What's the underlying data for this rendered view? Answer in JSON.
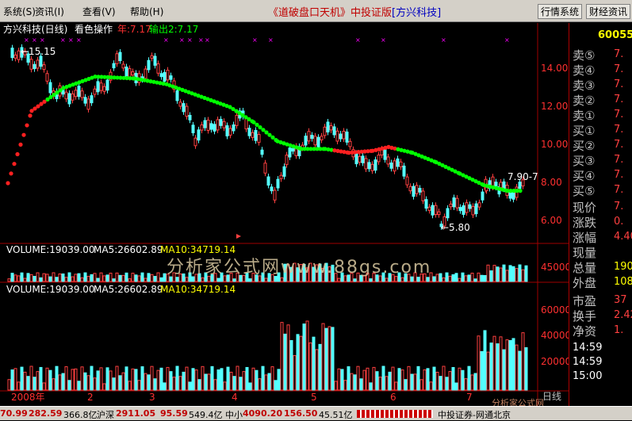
{
  "menu": {
    "items": [
      {
        "label": "系统(S)"
      },
      {
        "label": "资讯(I)"
      },
      {
        "label": "查看(V)"
      },
      {
        "label": "帮助(H)"
      }
    ],
    "title_prefix": "《道破盘口天机》中投证版",
    "title_stock": "[方兴科技]",
    "buttons": {
      "quote": "行情系统",
      "news": "财经资讯"
    }
  },
  "chart": {
    "header_name": "方兴科技(日线)",
    "header_mode": "看色操作",
    "header_in": "年:7.17",
    "header_out": "输出2:7.17",
    "label_high": "←15.15",
    "label_low": "←5.80",
    "label_last": "7.90-7",
    "volume_line": {
      "volume": "VOLUME:19039.00",
      "ma5": "MA5:26602.89",
      "ma10": "MA10:34719.14"
    },
    "volume2_line": {
      "volume": "VOLUME:19039.00",
      "ma5": "MA5:26602.89",
      "ma10": "MA10:34719.14"
    },
    "watermark": "分析家公式网www.88gs.com",
    "watermark2": "分析家公式网",
    "price_ticks": [
      "14.00",
      "12.00",
      "10.00",
      "8.00",
      "6.00"
    ],
    "vol1_ticks": [
      "45000"
    ],
    "vol2_ticks": [
      "60000",
      "40000",
      "20000"
    ],
    "x_labels": [
      "2008年",
      "2",
      "3",
      "4",
      "5",
      "6",
      "7"
    ],
    "tabs": [
      "日线",
      "笔",
      "价",
      "细"
    ]
  },
  "chart_data": {
    "type": "line",
    "title": "方兴科技(日线)",
    "xlabel": "",
    "ylabel": "",
    "ylim": [
      5.5,
      15.5
    ],
    "series_markers": {
      "high": 15.15,
      "low": 5.8,
      "last": 7.9
    }
  },
  "right_panel": {
    "code": "600552",
    "asks": [
      {
        "label": "卖⑤",
        "value": "7."
      },
      {
        "label": "卖④",
        "value": "7."
      },
      {
        "label": "卖③",
        "value": "7."
      },
      {
        "label": "卖②",
        "value": "7."
      },
      {
        "label": "卖①",
        "value": "7."
      }
    ],
    "bids": [
      {
        "label": "买①",
        "value": "7."
      },
      {
        "label": "买②",
        "value": "7."
      },
      {
        "label": "买③",
        "value": "7."
      },
      {
        "label": "买④",
        "value": "7."
      },
      {
        "label": "买⑤",
        "value": "7."
      }
    ],
    "stats": [
      {
        "label": "现价",
        "value": "7."
      },
      {
        "label": "涨跌",
        "value": "0."
      },
      {
        "label": "涨幅",
        "value": "4.40"
      },
      {
        "label": "现量",
        "value": ""
      },
      {
        "label": "总量",
        "value": "190"
      },
      {
        "label": "外盘",
        "value": "108"
      },
      {
        "label": "市盈",
        "value": "37"
      },
      {
        "label": "换手",
        "value": "2.42"
      },
      {
        "label": "净资",
        "value": "1."
      }
    ],
    "times": [
      "14:59",
      "14:59",
      "15:00"
    ],
    "tab": "笔"
  },
  "status": {
    "a_val": "70.99",
    "a_chg": "282.59",
    "a_amt": "366.8亿",
    "hs_label": "沪深",
    "hs_val": "2911.05",
    "hs_chg": "95.59",
    "hs_amt": "549.4亿",
    "zx_label": "中小",
    "zx_val": "4090.20",
    "zx_chg": "156.50",
    "zx_amt": "45.51亿",
    "broker": "中投证券-网通北京"
  }
}
